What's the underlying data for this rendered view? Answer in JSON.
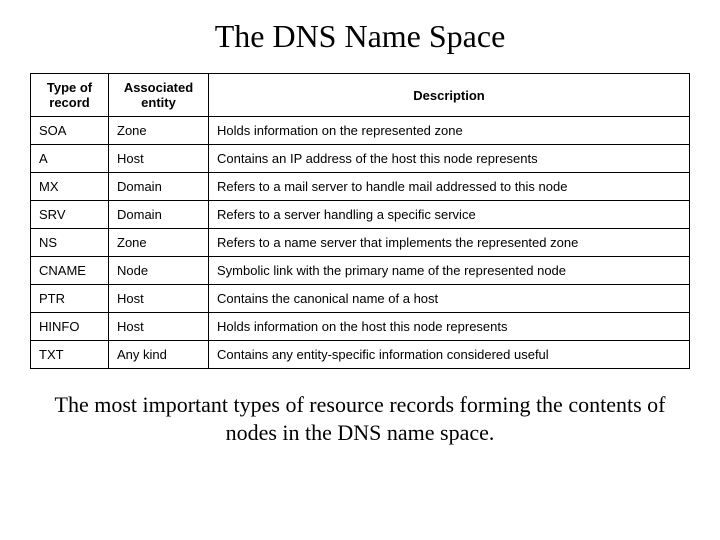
{
  "title": "The DNS Name Space",
  "headers": {
    "type": "Type of record",
    "entity": "Associated entity",
    "desc": "Description"
  },
  "rows": [
    {
      "type": "SOA",
      "entity": "Zone",
      "desc": "Holds information on the represented zone"
    },
    {
      "type": "A",
      "entity": "Host",
      "desc": "Contains an IP address of the host this node represents"
    },
    {
      "type": "MX",
      "entity": "Domain",
      "desc": "Refers to a mail server to handle mail addressed to this node"
    },
    {
      "type": "SRV",
      "entity": "Domain",
      "desc": "Refers to a server handling a specific service"
    },
    {
      "type": "NS",
      "entity": "Zone",
      "desc": "Refers to a name server that implements the represented zone"
    },
    {
      "type": "CNAME",
      "entity": "Node",
      "desc": "Symbolic link with the primary name of the represented node"
    },
    {
      "type": "PTR",
      "entity": "Host",
      "desc": "Contains the canonical name of a host"
    },
    {
      "type": "HINFO",
      "entity": "Host",
      "desc": "Holds information on the host this node represents"
    },
    {
      "type": "TXT",
      "entity": "Any kind",
      "desc": "Contains any entity-specific information considered useful"
    }
  ],
  "caption": "The most important types of resource records forming the contents of nodes in the DNS name space.",
  "chart_data": {
    "type": "table",
    "columns": [
      "Type of record",
      "Associated entity",
      "Description"
    ],
    "rows": [
      [
        "SOA",
        "Zone",
        "Holds information on the represented zone"
      ],
      [
        "A",
        "Host",
        "Contains an IP address of the host this node represents"
      ],
      [
        "MX",
        "Domain",
        "Refers to a mail server to handle mail addressed to this node"
      ],
      [
        "SRV",
        "Domain",
        "Refers to a server handling a specific service"
      ],
      [
        "NS",
        "Zone",
        "Refers to a name server that implements the represented zone"
      ],
      [
        "CNAME",
        "Node",
        "Symbolic link with the primary name of the represented node"
      ],
      [
        "PTR",
        "Host",
        "Contains the canonical name of a host"
      ],
      [
        "HINFO",
        "Host",
        "Holds information on the host this node represents"
      ],
      [
        "TXT",
        "Any kind",
        "Contains any entity-specific information considered useful"
      ]
    ]
  }
}
